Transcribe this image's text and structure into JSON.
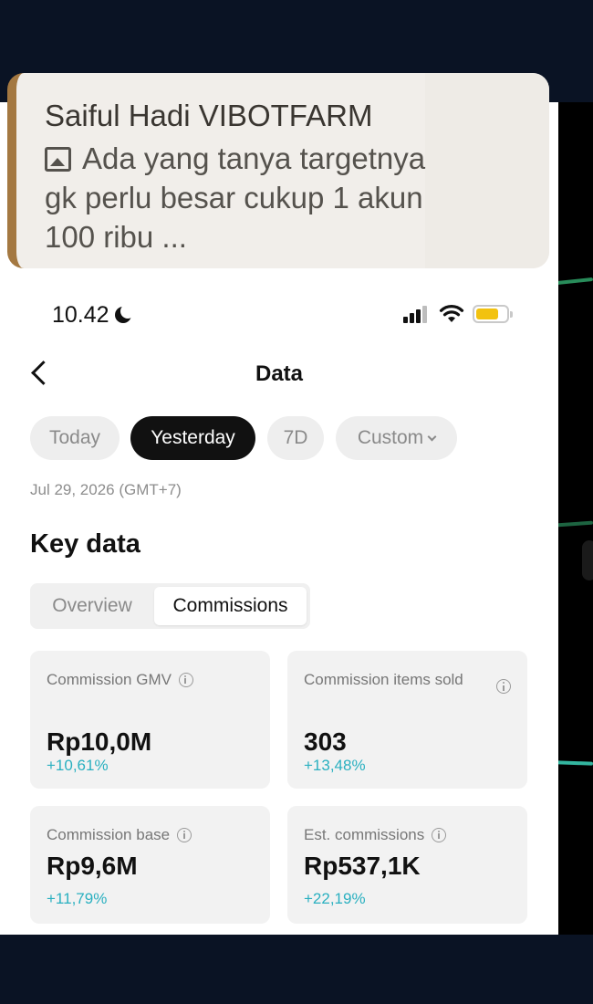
{
  "notification": {
    "sender": "Saiful Hadi VIBOTFARM",
    "message": "Ada yang tanya targetnya gk perlu besar cukup 1 akun 100 ribu ..."
  },
  "status_bar": {
    "time": "10.42"
  },
  "header": {
    "title": "Data"
  },
  "date_filters": {
    "today": "Today",
    "yesterday": "Yesterday",
    "seven_days": "7D",
    "custom": "Custom",
    "selected": "Yesterday"
  },
  "date_line": "Jul 29, 2026 (GMT+7)",
  "key_data": {
    "title": "Key data",
    "tabs": {
      "overview": "Overview",
      "commissions": "Commissions",
      "selected": "Commissions"
    },
    "cards": [
      {
        "label": "Commission GMV",
        "value": "Rp10,0M",
        "delta": "+10,61%"
      },
      {
        "label": "Commission items sold",
        "value": "303",
        "delta": "+13,48%"
      },
      {
        "label": "Commission base",
        "value": "Rp9,6M",
        "delta": "+11,79%"
      },
      {
        "label": "Est. commissions",
        "value": "Rp537,1K",
        "delta": "+22,19%"
      }
    ]
  },
  "colors": {
    "accent_delta": "#2ab0c0",
    "selected_pill": "#111111",
    "notification_bar": "#a47841",
    "battery": "#f2c20f"
  }
}
